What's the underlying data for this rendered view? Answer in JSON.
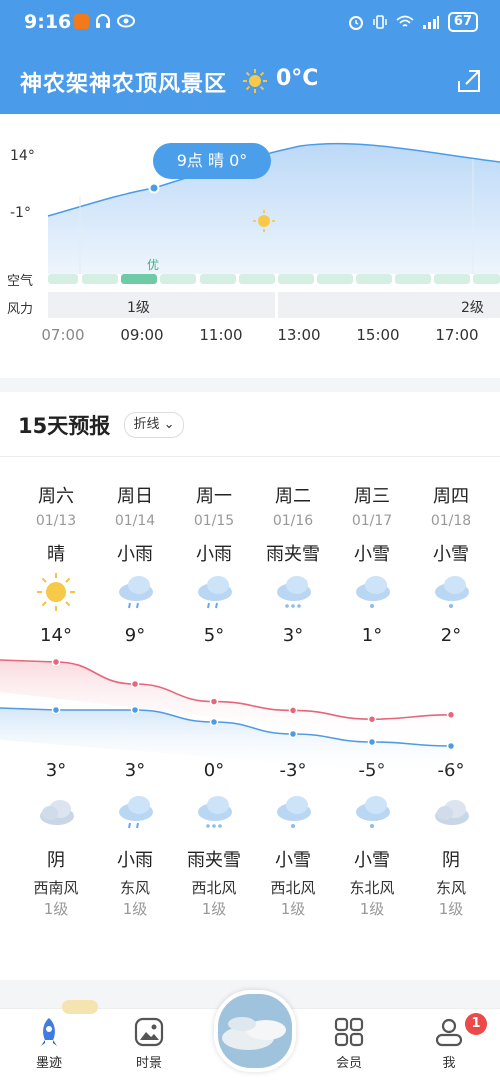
{
  "status": {
    "time": "9:16",
    "battery": "67"
  },
  "header": {
    "location": "神农架神农顶风景区",
    "current_temp": "0°C"
  },
  "hourly": {
    "y_labels": [
      "14°",
      "-1°"
    ],
    "row_labels": {
      "air": "空气",
      "wind": "风力"
    },
    "air_label": "优",
    "wind": [
      {
        "label": "1级"
      },
      {
        "label": "2级"
      }
    ],
    "hours": [
      "07:00",
      "09:00",
      "11:00",
      "13:00",
      "15:00",
      "17:00"
    ],
    "tooltip": "9点 晴 0°"
  },
  "forecast": {
    "title": "15天预报",
    "mode": "折线",
    "days": [
      {
        "weekday": "周六",
        "date": "01/13",
        "day_cond": "晴",
        "day_icon": "sun-icon",
        "high": "14°",
        "low": "3°",
        "night_icon": "cloud-icon",
        "night_cond": "阴",
        "wind_dir": "西南风",
        "wind_level": "1级"
      },
      {
        "weekday": "周日",
        "date": "01/14",
        "day_cond": "小雨",
        "day_icon": "rain-icon",
        "high": "9°",
        "low": "3°",
        "night_icon": "rain-icon",
        "night_cond": "小雨",
        "wind_dir": "东风",
        "wind_level": "1级"
      },
      {
        "weekday": "周一",
        "date": "01/15",
        "day_cond": "小雨",
        "day_icon": "rain-icon",
        "high": "5°",
        "low": "0°",
        "night_icon": "sleet-icon",
        "night_cond": "雨夹雪",
        "wind_dir": "西北风",
        "wind_level": "1级"
      },
      {
        "weekday": "周二",
        "date": "01/16",
        "day_cond": "雨夹雪",
        "day_icon": "sleet-icon",
        "high": "3°",
        "low": "-3°",
        "night_icon": "snow-icon",
        "night_cond": "小雪",
        "wind_dir": "西北风",
        "wind_level": "1级"
      },
      {
        "weekday": "周三",
        "date": "01/17",
        "day_cond": "小雪",
        "day_icon": "snow-icon",
        "high": "1°",
        "low": "-5°",
        "night_icon": "snow-icon",
        "night_cond": "小雪",
        "wind_dir": "东北风",
        "wind_level": "1级"
      },
      {
        "weekday": "周四",
        "date": "01/18",
        "day_cond": "小雪",
        "day_icon": "snow-icon",
        "high": "2°",
        "low": "-6°",
        "night_icon": "cloud-icon",
        "night_cond": "阴",
        "wind_dir": "东风",
        "wind_level": "1级"
      }
    ]
  },
  "nav": {
    "items": [
      {
        "label": "墨迹",
        "icon": "rocket-icon",
        "active": true
      },
      {
        "label": "时景",
        "icon": "picture-icon"
      },
      {
        "label": "会员",
        "icon": "grid-icon"
      },
      {
        "label": "我",
        "icon": "user-icon",
        "badge": "1"
      }
    ]
  },
  "chart_data": {
    "type": "line",
    "categories": [
      "01/13",
      "01/14",
      "01/15",
      "01/16",
      "01/17",
      "01/18"
    ],
    "series": [
      {
        "values": [
          14,
          9,
          5,
          3,
          1,
          2
        ]
      },
      {
        "values": [
          3,
          3,
          0,
          -3,
          -5,
          -6
        ]
      }
    ]
  },
  "colors": {
    "primary": "#4a9bea",
    "high_line": "#e7667a",
    "low_line": "#4f9be3",
    "air_good": "#6fcba6"
  }
}
